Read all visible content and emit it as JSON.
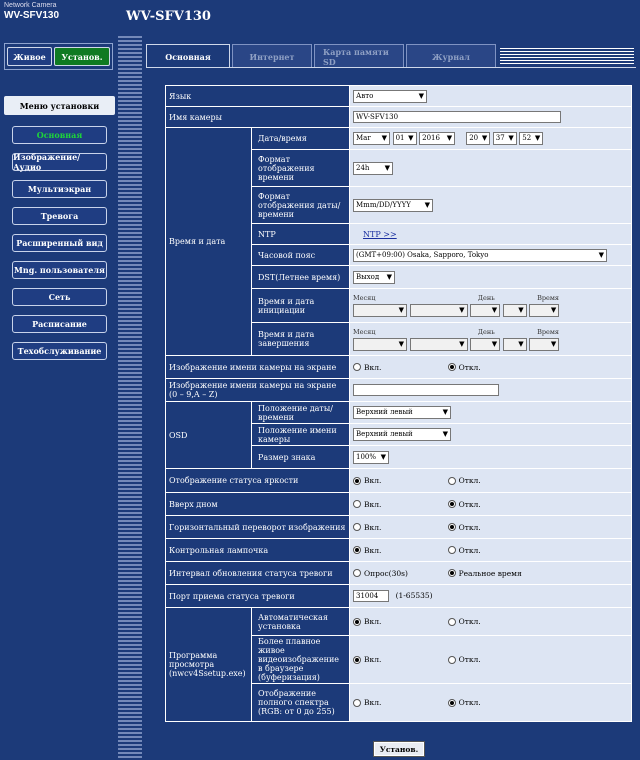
{
  "header": {
    "brand_line1": "Network Camera",
    "brand_line2": "WV-SFV130",
    "title": "WV-SFV130"
  },
  "top_buttons": {
    "live": "Живое",
    "setup": "Установ."
  },
  "menu": {
    "heading": "Меню установки",
    "items": [
      "Основная",
      "Изображение/Аудио",
      "Мультиэкран",
      "Тревога",
      "Расширенный вид",
      "Mng. пользователя",
      "Сеть",
      "Расписание",
      "Техобслуживание"
    ]
  },
  "tabs": [
    "Основная",
    "Интернет",
    "Карта памяти SD",
    "Журнал"
  ],
  "form": {
    "language": {
      "label": "Язык",
      "value": "Авто"
    },
    "camera_name": {
      "label": "Имя камеры",
      "value": "WV-SFV130"
    },
    "time_date": {
      "label": "Время и дата",
      "datetime": {
        "label": "Дата/время",
        "month": "Mar",
        "day": "01",
        "year": "2016",
        "hour": "20",
        "minute": "37",
        "second": "52"
      },
      "time_format": {
        "label": "Формат отображения времени",
        "value": "24h"
      },
      "date_format": {
        "label": "Формат отображения даты/времени",
        "value": "Mmm/DD/YYYY"
      },
      "ntp": {
        "label": "NTP",
        "link": "NTP >>"
      },
      "timezone": {
        "label": "Часовой пояс",
        "value": "(GMT+09:00) Osaka, Sapporo, Tokyo"
      },
      "dst": {
        "label": "DST(Летнее время)",
        "value": "Выход"
      },
      "start": {
        "label": "Время и дата инициации",
        "month": "Месяц",
        "day": "День",
        "time": "Время"
      },
      "end": {
        "label": "Время и дата завершения",
        "month": "Месяц",
        "day": "День",
        "time": "Время"
      }
    },
    "cam_name_on_screen": {
      "label": "Изображение имени камеры на экране",
      "on": "Вкл.",
      "off": "Откл."
    },
    "cam_name_on_screen_text": {
      "label": "Изображение имени камеры на экране (0 – 9,A – Z)",
      "value": ""
    },
    "osd": {
      "label": "OSD",
      "date_position": {
        "label": "Положение даты/времени",
        "value": "Верхний левый"
      },
      "name_position": {
        "label": "Положение имени камеры",
        "value": "Верхний левый"
      },
      "char_size": {
        "label": "Размер знака",
        "value": "100%"
      }
    },
    "brightness_status": {
      "label": "Отображение статуса яркости",
      "on": "Вкл.",
      "off": "Откл."
    },
    "upside_down": {
      "label": "Вверх дном",
      "on": "Вкл.",
      "off": "Откл."
    },
    "horizontal_flip": {
      "label": "Горизонтальный переворот изображения",
      "on": "Вкл.",
      "off": "Откл."
    },
    "control_lamp": {
      "label": "Контрольная лампочка",
      "on": "Вкл.",
      "off": "Откл."
    },
    "alarm_interval": {
      "label": "Интервал обновления статуса тревоги",
      "polling": "Опрос(30s)",
      "realtime": "Реальное время"
    },
    "alarm_port": {
      "label": "Порт приема статуса тревоги",
      "value": "31004",
      "range": "(1-65535)"
    },
    "viewer": {
      "label": "Программа просмотра (nwcv4Ssetup.exe)",
      "auto_install": {
        "label": "Автоматическая установка",
        "on": "Вкл.",
        "off": "Откл."
      },
      "smooth": {
        "label": "Более плавное живое видеоизображение в браузере (буферизация)",
        "on": "Вкл.",
        "off": "Откл."
      },
      "full_range": {
        "label": "Отображение полного спектра (RGB: от 0 до 255)",
        "on": "Вкл.",
        "off": "Откл."
      }
    }
  },
  "save_button": "Установ."
}
